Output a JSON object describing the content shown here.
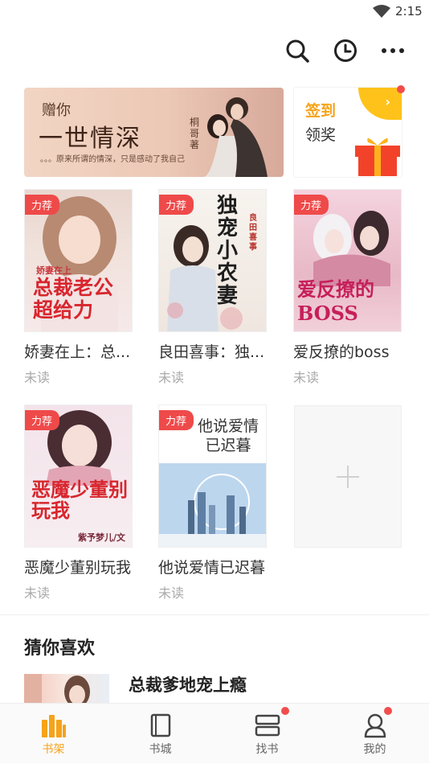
{
  "status_bar": {
    "time": "2:15"
  },
  "toolbar": {
    "icons": [
      "search-icon",
      "history-clock-icon",
      "more-icon"
    ]
  },
  "banner": {
    "line1": "赠你",
    "line2": "一世情深",
    "author": "桐哥著",
    "subtitle": "。。。原来所谓的情深，只是感动了我自己"
  },
  "signin": {
    "line1": "签到",
    "line2": "领奖"
  },
  "shelf": {
    "badge": "力荐",
    "books": [
      {
        "title": "娇妻在上：总...",
        "status": "未读",
        "cover_text": "总裁老公超给力",
        "cover_sub": "娇妻在上"
      },
      {
        "title": "良田喜事：独...",
        "status": "未读",
        "cover_text": "独宠小农妻",
        "cover_sub": "良田喜事"
      },
      {
        "title": "爱反撩的boss",
        "status": "未读",
        "cover_text": "爱反撩的BOSS",
        "cover_sub": ""
      },
      {
        "title": "恶魔少董别玩我",
        "status": "未读",
        "cover_text": "恶魔少董别玩我",
        "cover_sub": "紫予梦儿/文"
      },
      {
        "title": "他说爱情已迟暮",
        "status": "未读",
        "cover_text": "他说爱情已迟暮",
        "cover_sub": ""
      }
    ]
  },
  "recommend": {
    "section_title": "猜你喜欢",
    "first_title": "总裁爹地宠上瘾"
  },
  "tabbar": {
    "tabs": [
      {
        "label": "书架",
        "active": true
      },
      {
        "label": "书城",
        "active": false
      },
      {
        "label": "找书",
        "active": false
      },
      {
        "label": "我的",
        "active": false
      }
    ]
  },
  "colors": {
    "accent": "#f5a31a",
    "badge_red": "#ef4a4a",
    "dot_red": "#f24d4d"
  }
}
